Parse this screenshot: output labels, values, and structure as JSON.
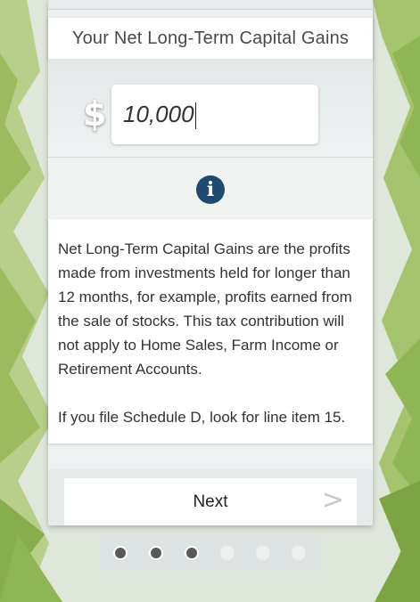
{
  "header": {
    "title": "Your Net Long-Term Capital Gains"
  },
  "input": {
    "currency_symbol": "$",
    "value": "10,000"
  },
  "info": {
    "icon": "info-circle-icon",
    "paragraphs": [
      "Net Long-Term Capital Gains are the profits made from investments held for longer than 12 months, for example, profits earned from the sale of stocks. This tax contribution will not apply to Home Sales, Farm Income or Retirement Accounts.",
      "If you file Schedule D, look for line item 15."
    ]
  },
  "navigation": {
    "next_label": "Next",
    "next_arrow": ">"
  },
  "progress": {
    "total_steps": 6,
    "current_step": 3
  },
  "colors": {
    "info_icon": "#1d4a6e",
    "active_dot": "#5a5a5a",
    "forest_green": "#9bbb5e"
  }
}
